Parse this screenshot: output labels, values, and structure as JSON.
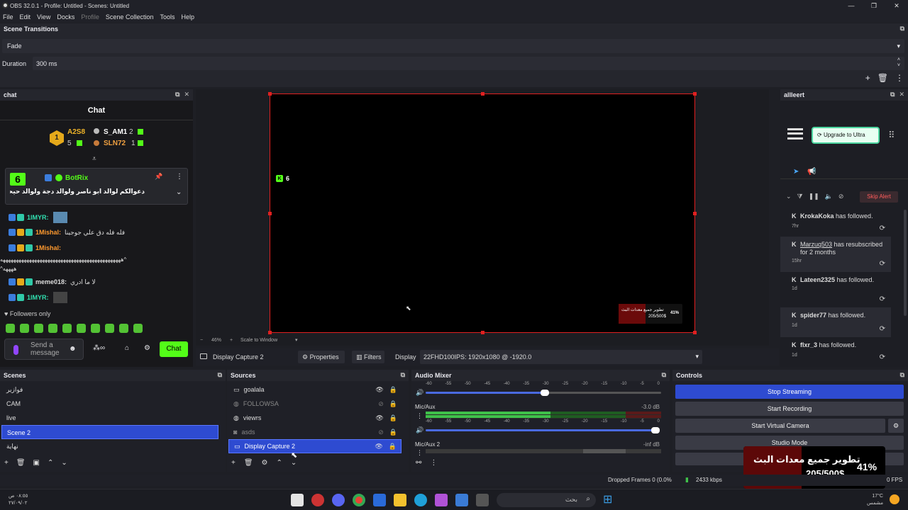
{
  "window": {
    "title": "OBS 32.0.1 - Profile: Untitled - Scenes: Untitled"
  },
  "menu": [
    "File",
    "Edit",
    "View",
    "Docks",
    "Profile",
    "Scene Collection",
    "Tools",
    "Help"
  ],
  "scene_transitions": {
    "title": "Scene Transitions",
    "transition": "Fade",
    "duration_label": "Duration",
    "duration_value": "300 ms"
  },
  "chat_dock": {
    "title": "chat",
    "header": "Chat",
    "leaderboard": [
      {
        "rank": "1",
        "name": "A2S8",
        "count": ""
      },
      {
        "rank": "",
        "name": "S_AM1",
        "count": "2"
      },
      {
        "rank": "",
        "name": "5",
        "count": ""
      },
      {
        "rank": "",
        "name": "SLN72",
        "count": "1"
      }
    ],
    "pinned": {
      "user": "BotRix",
      "text": "دعوالكم لوالد ابو ناصر ولوالد دجة ولوالد حيحي",
      "number": "6"
    },
    "messages": [
      {
        "user": "1IMYR:",
        "text": "",
        "color": "#30e0b0"
      },
      {
        "user": "1Mishal:",
        "text": "فله فله دق علي جوجينا",
        "color": "#ff9a2e"
      },
      {
        "user": "1Mishal:",
        "text": "",
        "color": "#ff9a2e"
      },
      {
        "user": "",
        "text": "ههههههههههههههههههههههههههههههههههههههههههههههه^",
        "color": "#ddd"
      },
      {
        "user": "",
        "text": "^ههههه",
        "color": "#ddd"
      },
      {
        "user": "meme018:",
        "text": "لا ما ادري",
        "color": "#ddd"
      },
      {
        "user": "1IMYR:",
        "text": "",
        "color": "#30e0b0"
      }
    ],
    "followers_only": "Followers only",
    "input_placeholder": "Send a message",
    "chat_button": "Chat"
  },
  "preview": {
    "counter": "6",
    "zoom": "46%",
    "scale_label": "Scale to Window",
    "goal_text": "تطوير جميع معدات البث",
    "goal_amount": "205/500$",
    "goal_pct": "41%"
  },
  "source_bar": {
    "source": "Display Capture 2",
    "properties": "Properties",
    "filters": "Filters",
    "display_label": "Display",
    "display_value": "22FHD100IPS: 1920x1080 @ -1920.0"
  },
  "alerts_dock": {
    "title": "allleert",
    "upgrade": "Upgrade to Ultra",
    "skip": "Skip Alert",
    "items": [
      {
        "user": "KrokaKoka",
        "text": " has followed.",
        "time": "7hr"
      },
      {
        "user": "Marzuq503",
        "text": " has resubscribed for 2 months",
        "time": "15hr"
      },
      {
        "user": "Lateen2325",
        "text": " has followed.",
        "time": "1d"
      },
      {
        "user": "spider77",
        "text": " has followed.",
        "time": "1d"
      },
      {
        "user": "flxr_3",
        "text": " has followed.",
        "time": "1d"
      }
    ]
  },
  "scenes": {
    "title": "Scenes",
    "items": [
      "فوازير",
      "CAM",
      "live",
      "Scene 2",
      "نهاية"
    ],
    "selected": 3
  },
  "sources": {
    "title": "Sources",
    "items": [
      {
        "name": "goalala",
        "visible": true
      },
      {
        "name": "FOLLOWSA",
        "visible": false
      },
      {
        "name": "viewrs",
        "visible": true
      },
      {
        "name": "asds",
        "visible": false
      },
      {
        "name": "Display Capture 2",
        "visible": true
      }
    ],
    "selected": 4
  },
  "mixer": {
    "title": "Audio Mixer",
    "ticks": [
      "-60",
      "-55",
      "-50",
      "-45",
      "-40",
      "-35",
      "-30",
      "-25",
      "-20",
      "-15",
      "-10",
      "-5",
      "0"
    ],
    "channels": [
      {
        "name": "Mic/Aux",
        "db": "-3.0 dB",
        "level": 0.6
      },
      {
        "name": "Mic/Aux 2",
        "db": "-inf dB",
        "level": 0
      }
    ]
  },
  "controls": {
    "title": "Controls",
    "buttons": [
      "Stop Streaming",
      "Start Recording",
      "Start Virtual Camera",
      "Studio Mode"
    ]
  },
  "status": {
    "dropped": "Dropped Frames 0 (0.0%",
    "kbps": "2433 kbps",
    "fps": "0 FPS"
  },
  "overlay_goal": {
    "text": "تطوير جميع معدات البث",
    "amount": "205/500$",
    "pct": "41%"
  },
  "taskbar": {
    "time": "٠٨:٥٥ ص",
    "date": "٢٧/٠٩/٠٢",
    "search": "بحث",
    "temp": "17°C",
    "weather": "مشمس"
  }
}
